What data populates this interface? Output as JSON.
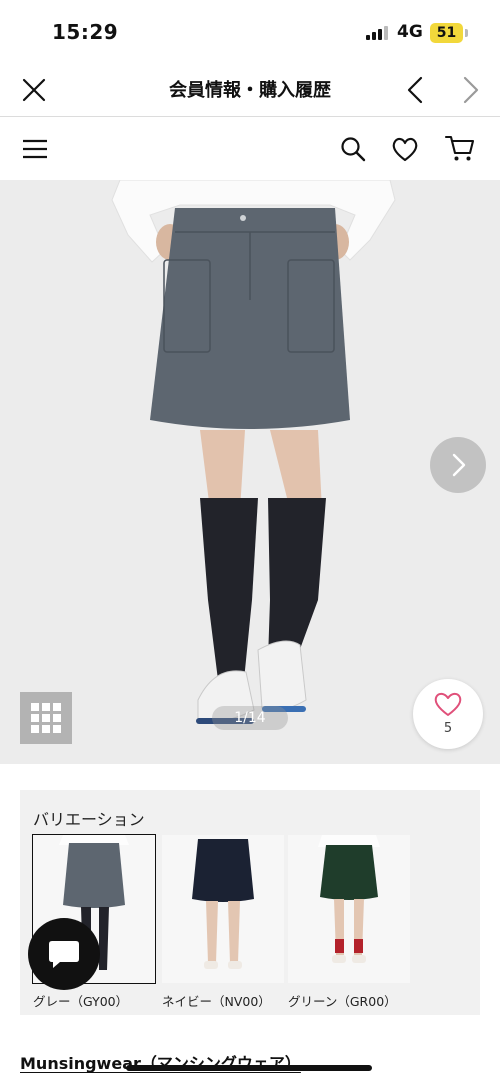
{
  "status_bar": {
    "time": "15:29",
    "network": "4G",
    "battery": "51"
  },
  "web_nav": {
    "title": "会員情報・購入履歴",
    "icons": [
      "close-icon",
      "chevron-left-icon",
      "chevron-right-icon"
    ]
  },
  "site_header": {
    "icons": [
      "hamburger-menu-icon",
      "search-icon",
      "heart-icon",
      "cart-icon"
    ]
  },
  "gallery": {
    "page_indicator": "1/14",
    "like_count": "5",
    "icons": [
      "chevron-right-icon",
      "grid-icon",
      "heart-icon"
    ]
  },
  "variations": {
    "title": "バリエーション",
    "items": [
      {
        "label": "グレー（GY00）",
        "color": "#5d6670",
        "selected": true
      },
      {
        "label": "ネイビー（NV00）",
        "color": "#1b2233",
        "selected": false
      },
      {
        "label": "グリーン（GR00）",
        "color": "#1f3d2b",
        "selected": false
      }
    ]
  },
  "chat": {
    "icon": "chat-bubble-icon"
  },
  "brand": {
    "link_text": "Munsingwear（マンシングウェア）"
  },
  "colors": {
    "battery": "#f2d83b",
    "panel_bg": "#f1f1f1",
    "skirt_gray": "#5d6670"
  }
}
